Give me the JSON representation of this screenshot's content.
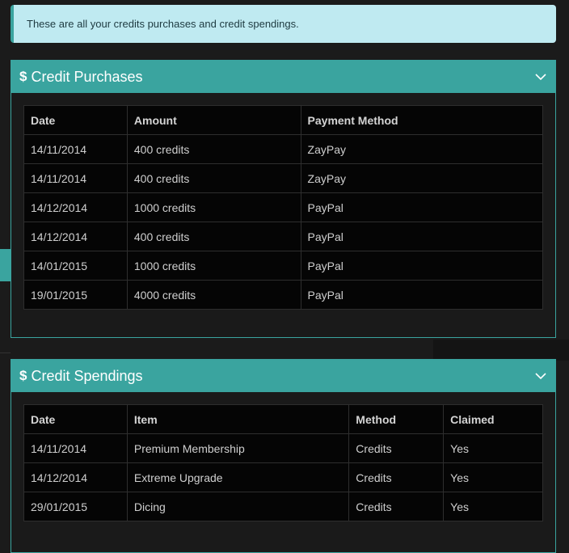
{
  "alert": {
    "text": "These are all your credits purchases and credit spendings."
  },
  "purchases": {
    "icon": "$",
    "title": "Credit Purchases",
    "columns": [
      "Date",
      "Amount",
      "Payment Method"
    ],
    "rows": [
      [
        "14/11/2014",
        "400 credits",
        "ZayPay"
      ],
      [
        "14/11/2014",
        "400 credits",
        "ZayPay"
      ],
      [
        "14/12/2014",
        "1000 credits",
        "PayPal"
      ],
      [
        "14/12/2014",
        "400 credits",
        "PayPal"
      ],
      [
        "14/01/2015",
        "1000 credits",
        "PayPal"
      ],
      [
        "19/01/2015",
        "4000 credits",
        "PayPal"
      ]
    ]
  },
  "spendings": {
    "icon": "$",
    "title": "Credit Spendings",
    "columns": [
      "Date",
      "Item",
      "Method",
      "Claimed"
    ],
    "rows": [
      [
        "14/11/2014",
        "Premium Membership",
        "Credits",
        "Yes"
      ],
      [
        "14/12/2014",
        "Extreme Upgrade",
        "Credits",
        "Yes"
      ],
      [
        "29/01/2015",
        "Dicing",
        "Credits",
        "Yes"
      ]
    ]
  },
  "colors": {
    "accent": "#3aa49f",
    "alert_bg": "#bfeaf1",
    "page_bg": "#1b1b1b",
    "table_bg": "#050505"
  },
  "icons": {
    "panel_header": "dollar-icon",
    "collapse": "chevron-down-icon"
  }
}
